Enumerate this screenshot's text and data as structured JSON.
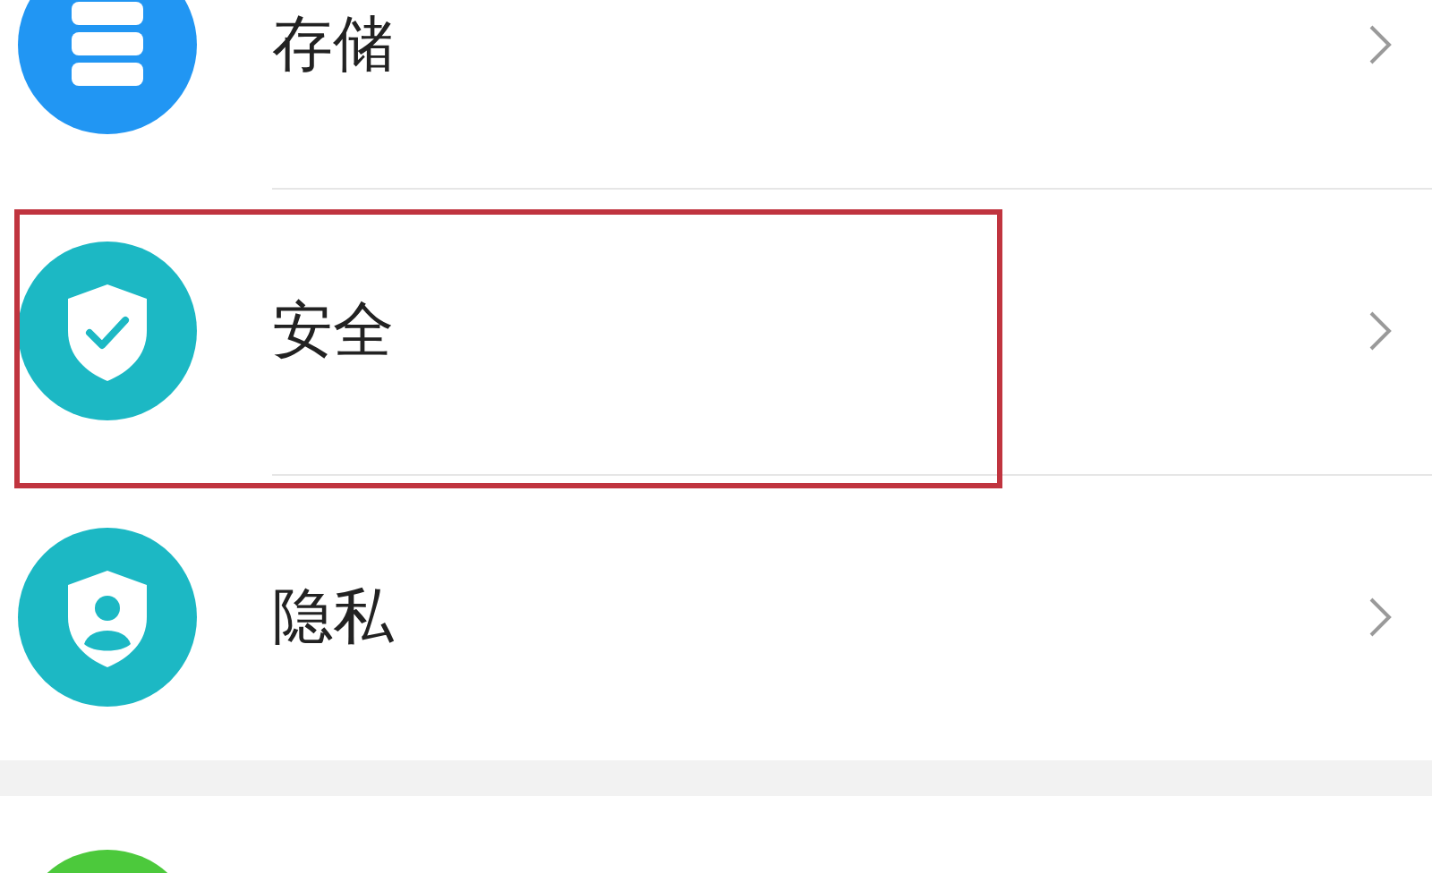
{
  "groups": [
    {
      "items": [
        {
          "kind": "storage",
          "color": "#2196f3",
          "label": "存储",
          "highlighted": false
        },
        {
          "kind": "security",
          "color": "#1cb8c4",
          "label": "安全",
          "highlighted": true
        },
        {
          "kind": "privacy",
          "color": "#1cb8c4",
          "label": "隐私",
          "highlighted": false
        }
      ]
    },
    {
      "items": [
        {
          "kind": "blank",
          "color": "#4cc93c",
          "highlighted": false
        }
      ]
    }
  ]
}
